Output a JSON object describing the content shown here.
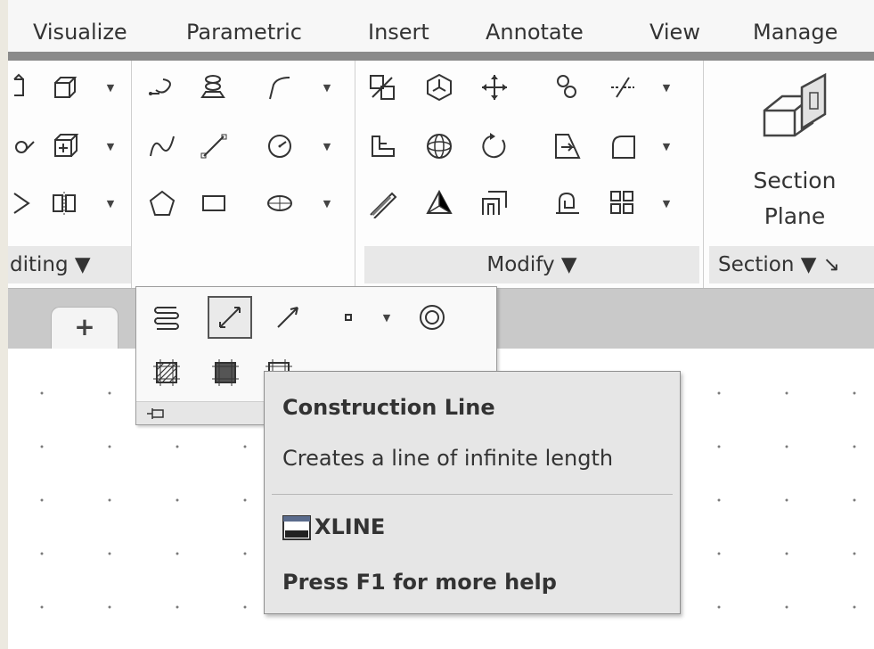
{
  "ribbon_tabs": [
    "Visualize",
    "Parametric",
    "Insert",
    "Annotate",
    "View",
    "Manage"
  ],
  "panels": {
    "editing": {
      "title": "diting ▼"
    },
    "modify": {
      "title": "Modify ▼"
    },
    "section": {
      "title": "Section ▼ ↘",
      "button_line1": "Section",
      "button_line2": "Plane"
    }
  },
  "doc_tabs": {
    "new_tab_label": "+"
  },
  "tooltip": {
    "title": "Construction Line",
    "description": "Creates a line of infinite length",
    "command": "XLINE",
    "help": "Press F1 for more help"
  }
}
